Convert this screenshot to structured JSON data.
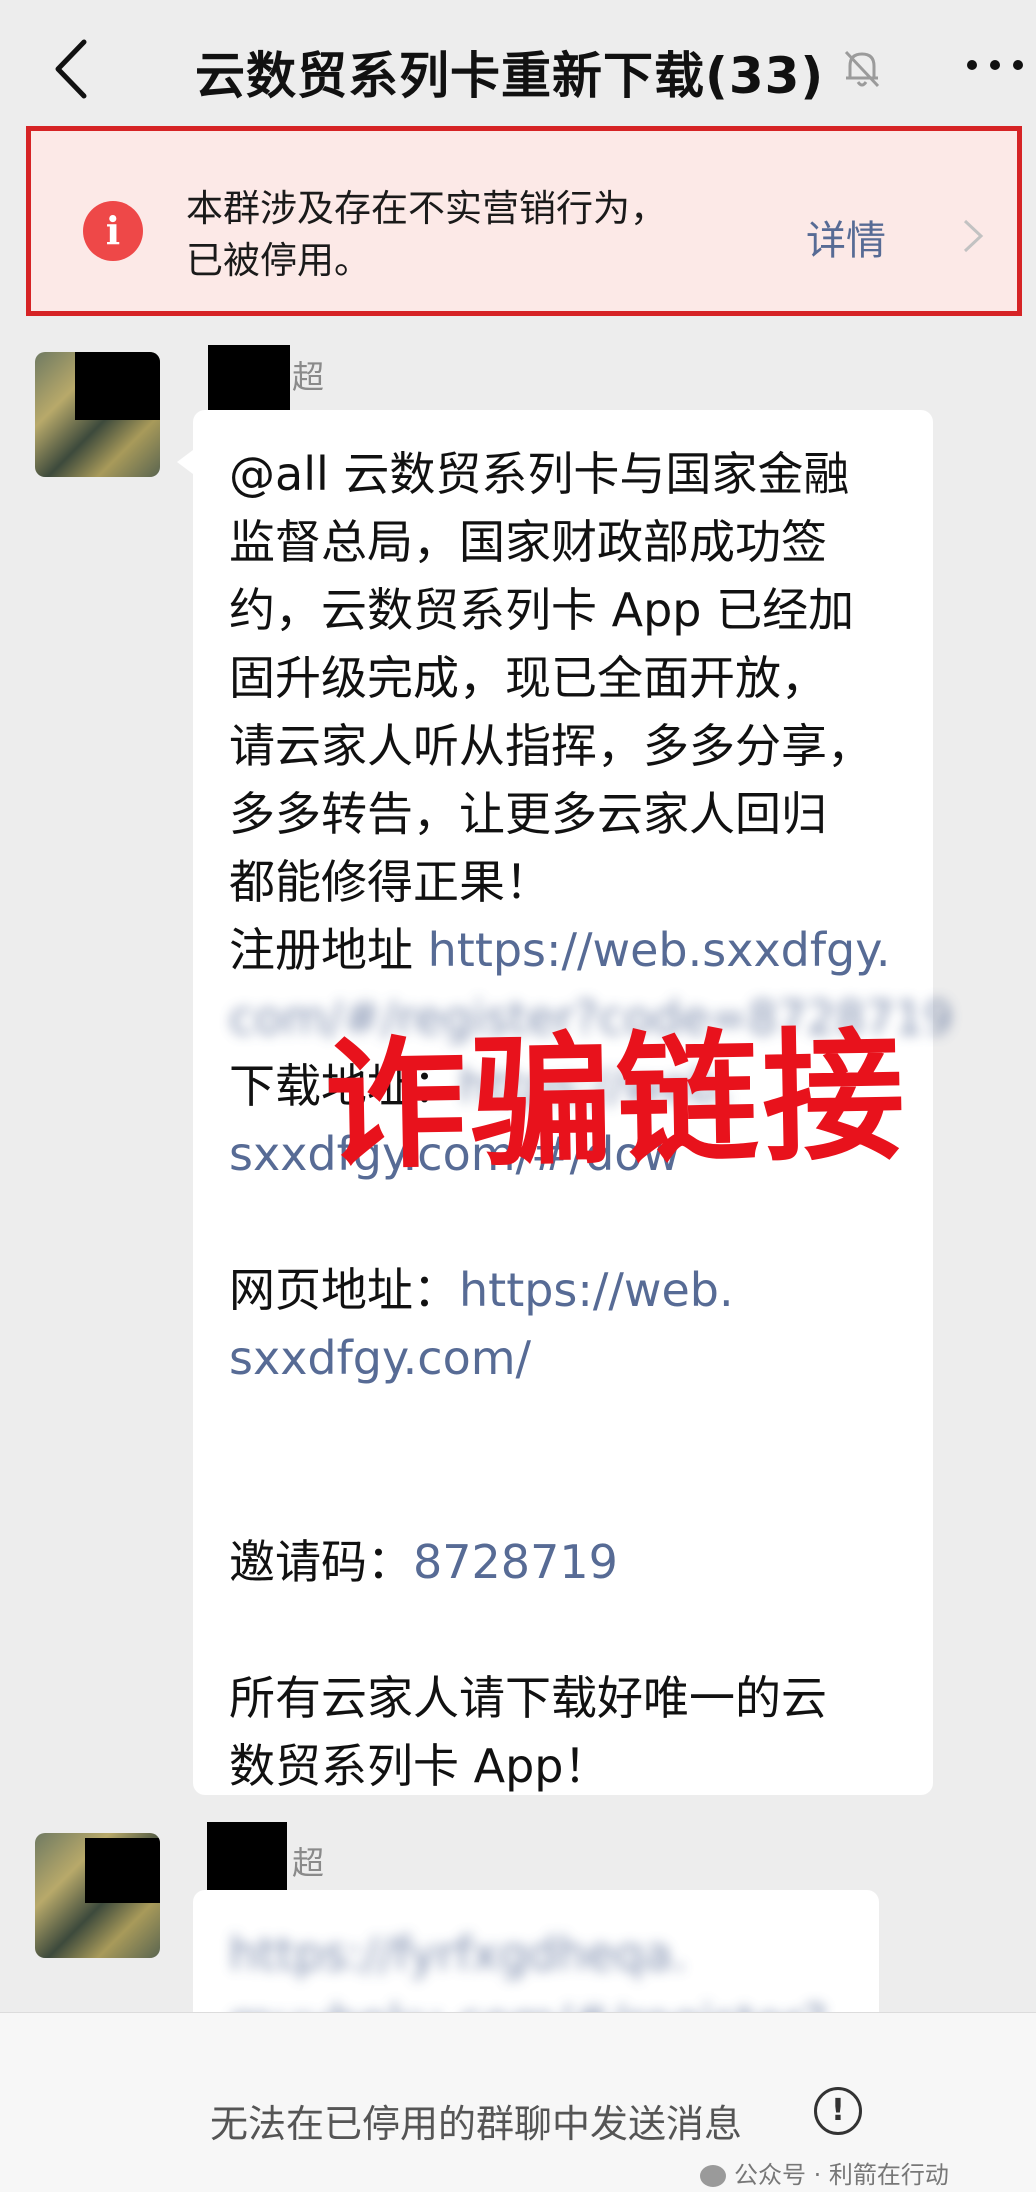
{
  "header": {
    "title": "云数贸系列卡重新下载(33)",
    "back_icon": "chevron-left-icon",
    "mute_icon": "bell-off-icon",
    "more_icon": "more-icon"
  },
  "banner": {
    "text_line1": "本群涉及存在不实营销行为，",
    "text_line2": "已被停用。",
    "detail_label": "详情",
    "icon": "info-icon",
    "accent": "#d62325"
  },
  "messages": [
    {
      "sender_suffix": "超",
      "lines": [
        "@all 云数贸系列卡与国家金融",
        "监督总局，国家财政部成功签",
        "约，云数贸系列卡 App 已经加",
        "固升级完成，现已全面开放，",
        "请云家人听从指挥，多多分享，",
        "多多转告，让更多云家人回归",
        "都能修得正果！"
      ],
      "register_label": "注册地址 ",
      "register_link_1": "https://web.sxxdfgy.",
      "register_link_2": "com/#/register?code=8728719",
      "download_label": "下载地址：",
      "download_link_1": "https://web.",
      "download_link_2": "sxxdfgy.com/#/dow",
      "web_label": "网页地址：",
      "web_link_1": "https://web.",
      "web_link_2": "sxxdfgy.com/",
      "invite_label": "邀请码：",
      "invite_code": "8728719",
      "closing_1": "所有云家人请下载好唯一的云",
      "closing_2": "数贸系列卡 App！"
    },
    {
      "sender_suffix": "超",
      "link_1": "https://fyrfxgdheqa.",
      "link_2": "muvbnku.com/#/register?"
    }
  ],
  "stamp": "诈骗链接",
  "footer": {
    "notice": "无法在已停用的群聊中发送消息",
    "icon": "alert-circle-icon"
  },
  "watermark": "公众号 · 利箭在行动"
}
